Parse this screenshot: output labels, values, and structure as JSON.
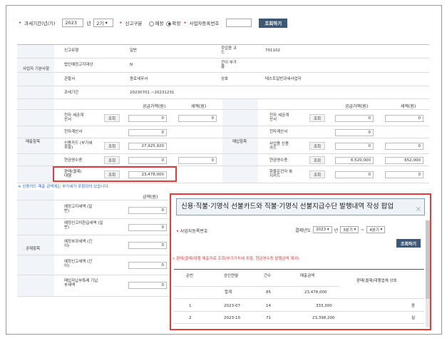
{
  "filter": {
    "period_label": "과세기간(년/기)",
    "year_value": "2023",
    "year_unit": "년",
    "term_value": "2기",
    "report_type_label": "신고구분",
    "radio_estimate": "예정",
    "radio_final": "확정",
    "bizno_label": "사업자등록번호",
    "search_button": "조회하기"
  },
  "basic": {
    "section_label": "사업자 기본사항",
    "rows": [
      {
        "k": "신고유형",
        "v": "일반",
        "k2": "주업종 코드",
        "v2": "701102"
      },
      {
        "k": "법인예정고지대상",
        "v": "N",
        "k2": "간이 부가율",
        "v2": ""
      },
      {
        "k": "관할서",
        "v": "종로세무서",
        "k2": "상호",
        "v2": "테스트일반과세사업자"
      },
      {
        "k": "과세기간",
        "v": "20230701 ~20231231",
        "k2": "",
        "v2": ""
      }
    ]
  },
  "sales": {
    "section_label": "매출항목",
    "purchase_label": "매입항목",
    "col_supply": "공급가액(원)",
    "col_tax": "세액(원)",
    "query_btn": "조회",
    "left_rows": [
      {
        "label": "전자 세금계산서",
        "btn": true,
        "supply": "0",
        "tax": "0"
      },
      {
        "label": "전자계산서",
        "btn": false,
        "supply": "0",
        "tax": ""
      },
      {
        "label": "신용카드 (부가세포함)",
        "btn": true,
        "supply": "27,925,920",
        "tax": ""
      },
      {
        "label": "현금영수증",
        "btn": true,
        "supply": "0",
        "tax": "0"
      },
      {
        "label": "판매(결제) 대행",
        "btn": true,
        "supply": "23,478,000",
        "tax": ""
      }
    ],
    "right_rows": [
      {
        "label": "전자 세금계산서",
        "btn": true,
        "supply": "0",
        "tax": "0"
      },
      {
        "label": "전자계산서",
        "btn": false,
        "supply": "0",
        "tax": ""
      },
      {
        "label": "사업용 신용카드",
        "btn": true,
        "supply": "0",
        "tax": "0"
      },
      {
        "label": "현금영수증",
        "btn": true,
        "supply": "6,520,000",
        "tax": "652,000"
      },
      {
        "label": "화물운전자 복지카드",
        "btn": true,
        "supply": "0",
        "tax": "0"
      }
    ]
  },
  "note": "※ 신용카드 매출 금액에는 부가세가 포함되어 있습니다.",
  "deduction": {
    "section_label": "공제항목",
    "col_amount": "금액(원)",
    "rows": [
      {
        "label": "예정고지세액 (일반)",
        "value": "0"
      },
      {
        "label": "예정신고미환급세액 (일반)",
        "value": "0"
      },
      {
        "label": "예정부과세액 (간이)",
        "value": "0"
      },
      {
        "label": "예정신고세액 (간이)",
        "value": "0"
      },
      {
        "label": "매입자납부특례 기납부세액",
        "value": "0"
      }
    ]
  },
  "popup": {
    "title": "신용·직불·기명식 선불카드와 직불·기명식 선불지급수단 발행내역 작성 팝업",
    "close": "×",
    "bizno_label": "사업자등록번호",
    "year_label": "결제년도",
    "year_value": "2023",
    "year_unit": "년",
    "q_from": "3분기",
    "q_sep": "~",
    "q_to": "4분기",
    "search_button": "조회하기",
    "warning": "판매(결제)대행 매출자료 조회(부가가치세 포함, 현금영수증 발행금액 제외)",
    "headers": [
      "순번",
      "승인연월",
      "건수",
      "매출금액",
      "판매(결제)대행업체 상호"
    ],
    "total": {
      "label": "합계",
      "count": "85",
      "amount": "23,478,000"
    },
    "rows": [
      {
        "no": "1",
        "ym": "2023-07",
        "count": "14",
        "amount": "333,300",
        "name": "응"
      },
      {
        "no": "2",
        "ym": "2023-10",
        "count": "71",
        "amount": "23,398,200",
        "name": "실"
      }
    ]
  }
}
